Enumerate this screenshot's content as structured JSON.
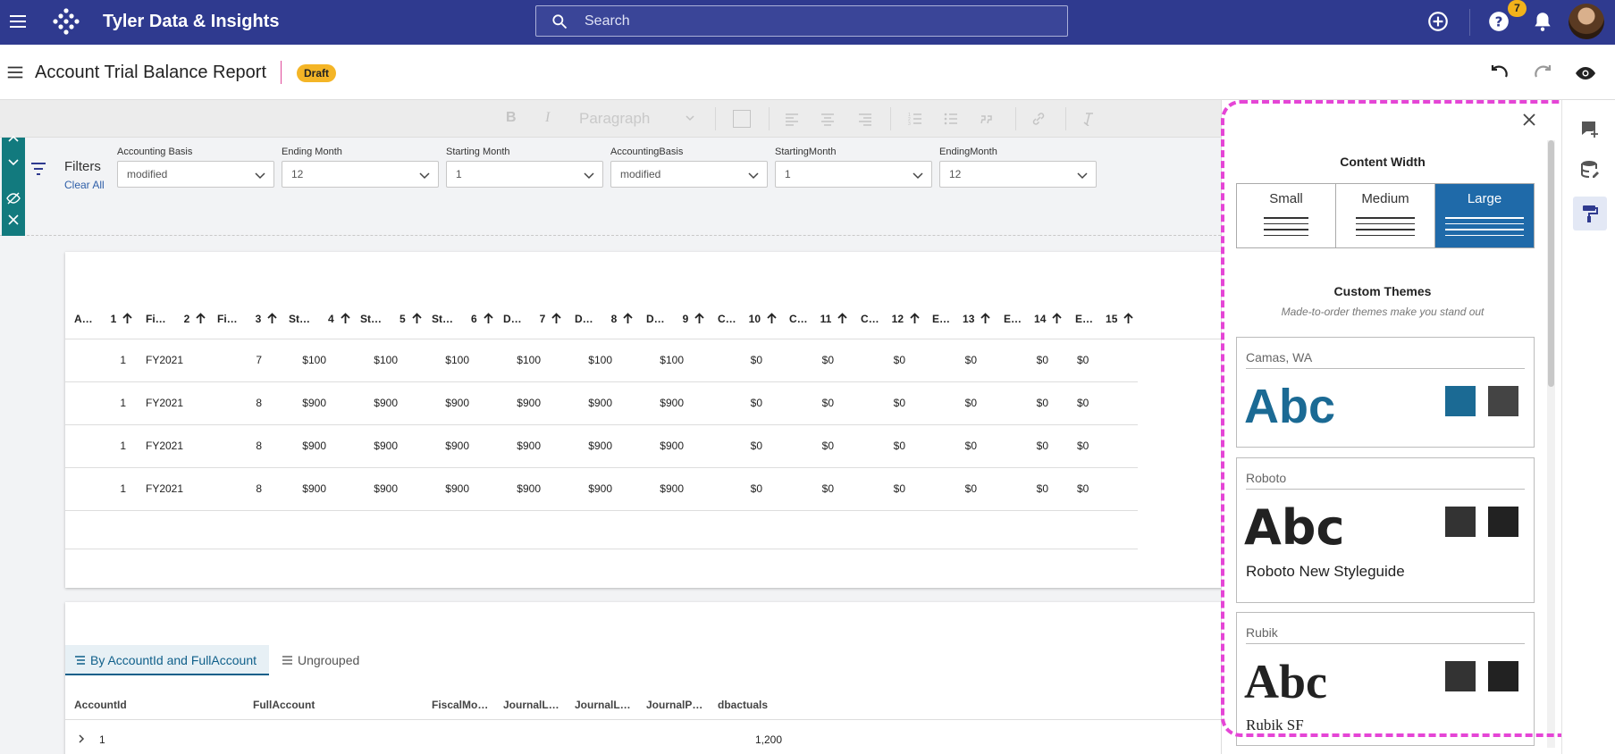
{
  "app": {
    "brand": "Tyler Data & Insights",
    "search_placeholder": "Search",
    "notification_count": "7"
  },
  "report": {
    "title": "Account Trial Balance Report",
    "status": "Draft"
  },
  "editor_toolbar": {
    "bold": "B",
    "italic": "I",
    "paragraph": "Paragraph"
  },
  "filters": {
    "label": "Filters",
    "clear_all": "Clear All",
    "items": [
      {
        "label": "Accounting Basis",
        "value": "modified"
      },
      {
        "label": "Ending Month",
        "value": "12"
      },
      {
        "label": "Starting Month",
        "value": "1"
      },
      {
        "label": "AccountingBasis",
        "value": "modified"
      },
      {
        "label": "StartingMonth",
        "value": "1"
      },
      {
        "label": "EndingMonth",
        "value": "12"
      }
    ]
  },
  "table": {
    "headers": [
      {
        "name": "A…",
        "num": "1"
      },
      {
        "name": "Fi…",
        "num": "2"
      },
      {
        "name": "Fi…",
        "num": "3"
      },
      {
        "name": "St…",
        "num": "4"
      },
      {
        "name": "St…",
        "num": "5"
      },
      {
        "name": "St…",
        "num": "6"
      },
      {
        "name": "D…",
        "num": "7"
      },
      {
        "name": "D…",
        "num": "8"
      },
      {
        "name": "D…",
        "num": "9"
      },
      {
        "name": "C…",
        "num": "10"
      },
      {
        "name": "C…",
        "num": "11"
      },
      {
        "name": "C…",
        "num": "12"
      },
      {
        "name": "E…",
        "num": "13"
      },
      {
        "name": "E…",
        "num": "14"
      },
      {
        "name": "E…",
        "num": "15"
      }
    ],
    "rows": [
      [
        "1",
        "FY2021",
        "7",
        "$100",
        "$100",
        "$100",
        "$100",
        "$100",
        "$100",
        "$0",
        "$0",
        "$0",
        "$0",
        "$0",
        "$0"
      ],
      [
        "1",
        "FY2021",
        "8",
        "$900",
        "$900",
        "$900",
        "$900",
        "$900",
        "$900",
        "$0",
        "$0",
        "$0",
        "$0",
        "$0",
        "$0"
      ],
      [
        "1",
        "FY2021",
        "8",
        "$900",
        "$900",
        "$900",
        "$900",
        "$900",
        "$900",
        "$0",
        "$0",
        "$0",
        "$0",
        "$0",
        "$0"
      ],
      [
        "1",
        "FY2021",
        "8",
        "$900",
        "$900",
        "$900",
        "$900",
        "$900",
        "$900",
        "$0",
        "$0",
        "$0",
        "$0",
        "$0",
        "$0"
      ]
    ]
  },
  "grouped": {
    "tabs": [
      "By AccountId and FullAccount",
      "Ungrouped"
    ],
    "headers": [
      "AccountId",
      "FullAccount",
      "FiscalMo…",
      "JournalL…",
      "JournalL…",
      "JournalP…",
      "dbactuals"
    ],
    "row": {
      "account": "1",
      "dbactuals": "1,200"
    }
  },
  "panel": {
    "content_width_title": "Content Width",
    "width_options": [
      "Small",
      "Medium",
      "Large"
    ],
    "selected_width": "Large",
    "custom_themes_title": "Custom Themes",
    "custom_themes_subtitle": "Made-to-order themes make you stand out",
    "themes": [
      {
        "name": "Camas, WA",
        "sample": "Abc",
        "subtitle": "",
        "colors": [
          "#1b6a94",
          "#444444"
        ]
      },
      {
        "name": "Roboto",
        "sample": "Abc",
        "subtitle": "Roboto New Styleguide",
        "colors": [
          "#333333",
          "#222222"
        ]
      },
      {
        "name": "Rubik",
        "sample": "Abc",
        "subtitle": "Rubik SF",
        "colors": [
          "#333333",
          "#222222"
        ]
      }
    ]
  },
  "colors": {
    "topbar": "#2f3a8f",
    "accent_teal": "#127a7e",
    "selected_blue": "#1f6aa9",
    "draft": "#f4b526",
    "highlight": "#e545d6"
  }
}
